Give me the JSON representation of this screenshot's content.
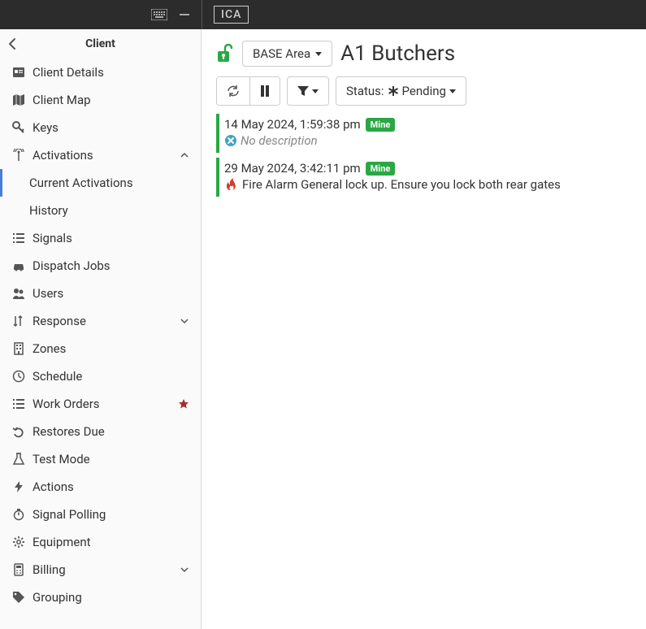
{
  "topbar": {
    "logo": "ICA"
  },
  "sidebar": {
    "title": "Client",
    "items": [
      {
        "id": "client-details",
        "label": "Client Details",
        "icon": "id-card"
      },
      {
        "id": "client-map",
        "label": "Client Map",
        "icon": "map"
      },
      {
        "id": "keys",
        "label": "Keys",
        "icon": "key"
      },
      {
        "id": "activations",
        "label": "Activations",
        "icon": "signal-tower",
        "expanded": true,
        "children": [
          {
            "id": "current-activations",
            "label": "Current Activations",
            "active": true
          },
          {
            "id": "history",
            "label": "History"
          }
        ]
      },
      {
        "id": "signals",
        "label": "Signals",
        "icon": "list"
      },
      {
        "id": "dispatch-jobs",
        "label": "Dispatch Jobs",
        "icon": "car"
      },
      {
        "id": "users",
        "label": "Users",
        "icon": "users"
      },
      {
        "id": "response",
        "label": "Response",
        "icon": "sort",
        "expandable": true
      },
      {
        "id": "zones",
        "label": "Zones",
        "icon": "building"
      },
      {
        "id": "schedule",
        "label": "Schedule",
        "icon": "clock"
      },
      {
        "id": "work-orders",
        "label": "Work Orders",
        "icon": "list",
        "starred": true
      },
      {
        "id": "restores-due",
        "label": "Restores Due",
        "icon": "undo"
      },
      {
        "id": "test-mode",
        "label": "Test Mode",
        "icon": "flask"
      },
      {
        "id": "actions",
        "label": "Actions",
        "icon": "bolt"
      },
      {
        "id": "signal-polling",
        "label": "Signal Polling",
        "icon": "stopwatch"
      },
      {
        "id": "equipment",
        "label": "Equipment",
        "icon": "gear"
      },
      {
        "id": "billing",
        "label": "Billing",
        "icon": "calculator",
        "expandable": true
      },
      {
        "id": "grouping",
        "label": "Grouping",
        "icon": "tag"
      }
    ]
  },
  "main": {
    "area_dropdown": "BASE Area",
    "client_name": "A1 Butchers",
    "status_filter_prefix": "Status:",
    "status_filter_value": "Pending",
    "entries": [
      {
        "timestamp": "14 May 2024, 1:59:38 pm",
        "badge": "Mine",
        "desc": "No description",
        "kind": "none"
      },
      {
        "timestamp": "29 May 2024, 3:42:11 pm",
        "badge": "Mine",
        "desc": "Fire Alarm General lock up. Ensure you lock both rear gates",
        "kind": "fire"
      }
    ]
  }
}
